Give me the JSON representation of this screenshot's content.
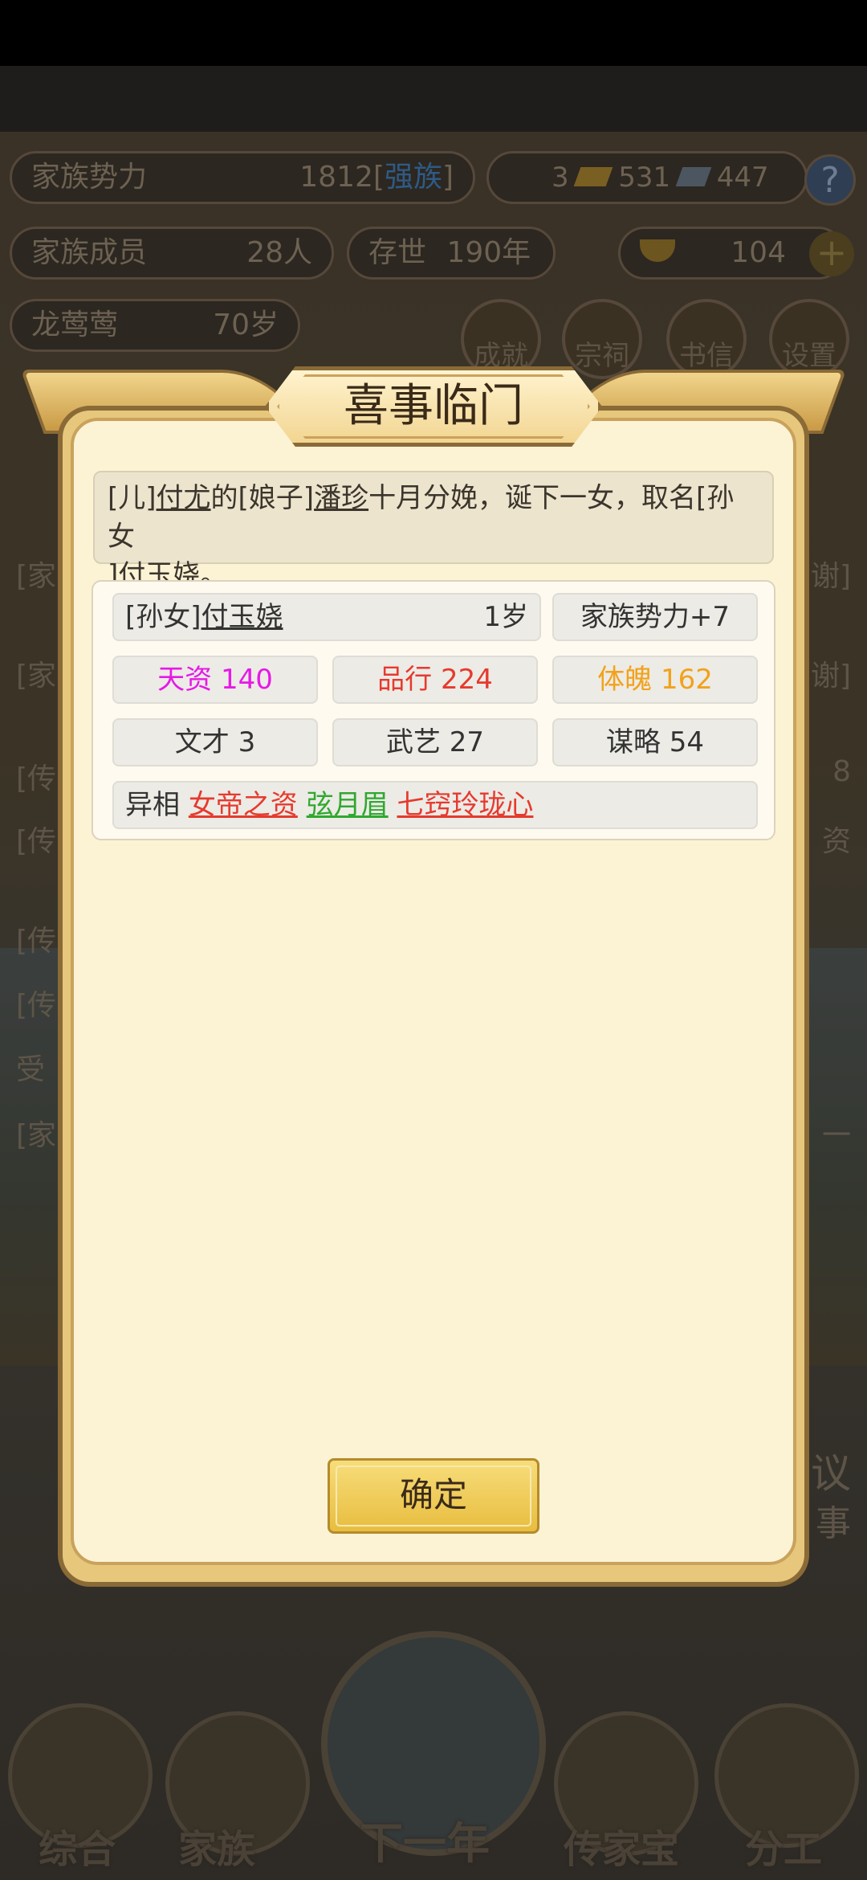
{
  "background": {
    "family_power_label": "家族势力",
    "family_power_value": "1812",
    "family_power_tag": "强族",
    "resources": {
      "gold_bars": "3",
      "silver": "531",
      "coins": "447"
    },
    "help_glyph": "?",
    "members_label": "家族成员",
    "members_value": "28人",
    "exist_label": "存世",
    "exist_value": "190年",
    "ingot_value": "104",
    "add_glyph": "+",
    "leader_name": "龙莺莺",
    "leader_age": "70岁",
    "icon_labels": [
      "成就",
      "宗祠",
      "书信",
      "设置"
    ],
    "partial_rows": [
      "[家",
      "[家",
      "[传",
      "[传",
      "[传",
      "[传",
      "受",
      "[家"
    ],
    "partial_right": [
      "谢]",
      "谢]",
      "8",
      "资",
      "一"
    ],
    "side_text": [
      "议",
      "事"
    ]
  },
  "bottom_nav": [
    {
      "label": "综合",
      "icon": "scroll-icon"
    },
    {
      "label": "家族",
      "icon": "temple-icon"
    },
    {
      "label": "下一年",
      "icon": "mountain-icon"
    },
    {
      "label": "传家宝",
      "icon": "jade-icon"
    },
    {
      "label": "分工",
      "icon": "people-icon"
    }
  ],
  "dialog": {
    "title": "喜事临门",
    "event": {
      "p1": "[儿]",
      "father": "付尤",
      "p2": "的[娘子]",
      "mother": "潘珍",
      "p3": "十月分娩，诞下一女，取名[孙女",
      "p4": "]",
      "child": "付玉娆",
      "p5": "。"
    },
    "child": {
      "relation": "[孙女]",
      "name": "付玉娆",
      "age": "1岁",
      "power_bonus": "家族势力+7",
      "stats": [
        {
          "label": "天资 140",
          "color": "#e619e6"
        },
        {
          "label": "品行 224",
          "color": "#e63a2e"
        },
        {
          "label": "体魄 162",
          "color": "#f2a21b"
        },
        {
          "label": "文才 3",
          "color": "#333333"
        },
        {
          "label": "武艺 27",
          "color": "#333333"
        },
        {
          "label": "谋略 54",
          "color": "#333333"
        }
      ],
      "traits_label": "异相",
      "traits": [
        {
          "name": "女帝之资",
          "color": "#e63a2e"
        },
        {
          "name": "弦月眉",
          "color": "#2fa82f"
        },
        {
          "name": "七窍玲珑心",
          "color": "#e63a2e"
        }
      ]
    },
    "confirm_label": "确定"
  }
}
